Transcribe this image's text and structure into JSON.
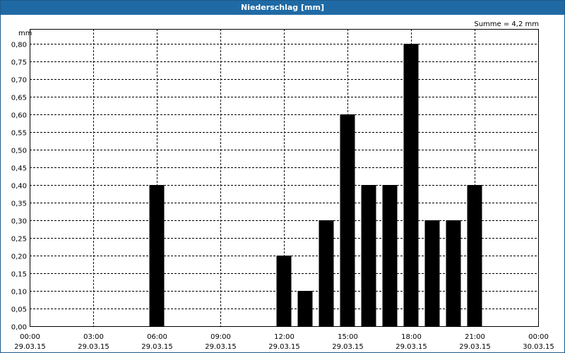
{
  "window": {
    "title": "Niederschlag [mm]"
  },
  "chart_data": {
    "type": "bar",
    "unit_label": "mm",
    "annotation": "Summe = 4,2 mm",
    "ylim": [
      0,
      0.8
    ],
    "y_ticks": [
      "0,00",
      "0,05",
      "0,10",
      "0,15",
      "0,20",
      "0,25",
      "0,30",
      "0,35",
      "0,40",
      "0,45",
      "0,50",
      "0,55",
      "0,60",
      "0,65",
      "0,70",
      "0,75",
      "0,80"
    ],
    "x_ticks": [
      {
        "time": "00:00",
        "date": "29.03.15"
      },
      {
        "time": "03:00",
        "date": "29.03.15"
      },
      {
        "time": "06:00",
        "date": "29.03.15"
      },
      {
        "time": "09:00",
        "date": "29.03.15"
      },
      {
        "time": "12:00",
        "date": "29.03.15"
      },
      {
        "time": "15:00",
        "date": "29.03.15"
      },
      {
        "time": "18:00",
        "date": "29.03.15"
      },
      {
        "time": "21:00",
        "date": "29.03.15"
      },
      {
        "time": "00:00",
        "date": "30.03.15"
      }
    ],
    "x_range": [
      "29.03.15 00:00",
      "30.03.15 00:00"
    ],
    "bar_width_hours": 0.7,
    "bars": [
      {
        "x": "29.03.15 06:00",
        "value": 0.4
      },
      {
        "x": "29.03.15 12:00",
        "value": 0.2
      },
      {
        "x": "29.03.15 13:00",
        "value": 0.1
      },
      {
        "x": "29.03.15 14:00",
        "value": 0.3
      },
      {
        "x": "29.03.15 15:00",
        "value": 0.6
      },
      {
        "x": "29.03.15 16:00",
        "value": 0.4
      },
      {
        "x": "29.03.15 17:00",
        "value": 0.4
      },
      {
        "x": "29.03.15 18:00",
        "value": 0.8
      },
      {
        "x": "29.03.15 19:00",
        "value": 0.3
      },
      {
        "x": "29.03.15 20:00",
        "value": 0.3
      },
      {
        "x": "29.03.15 21:00",
        "value": 0.4
      }
    ],
    "grid": true,
    "colors": {
      "bar": "#000000",
      "grid": "#000000",
      "titlebar": "#1f6aa5"
    }
  }
}
